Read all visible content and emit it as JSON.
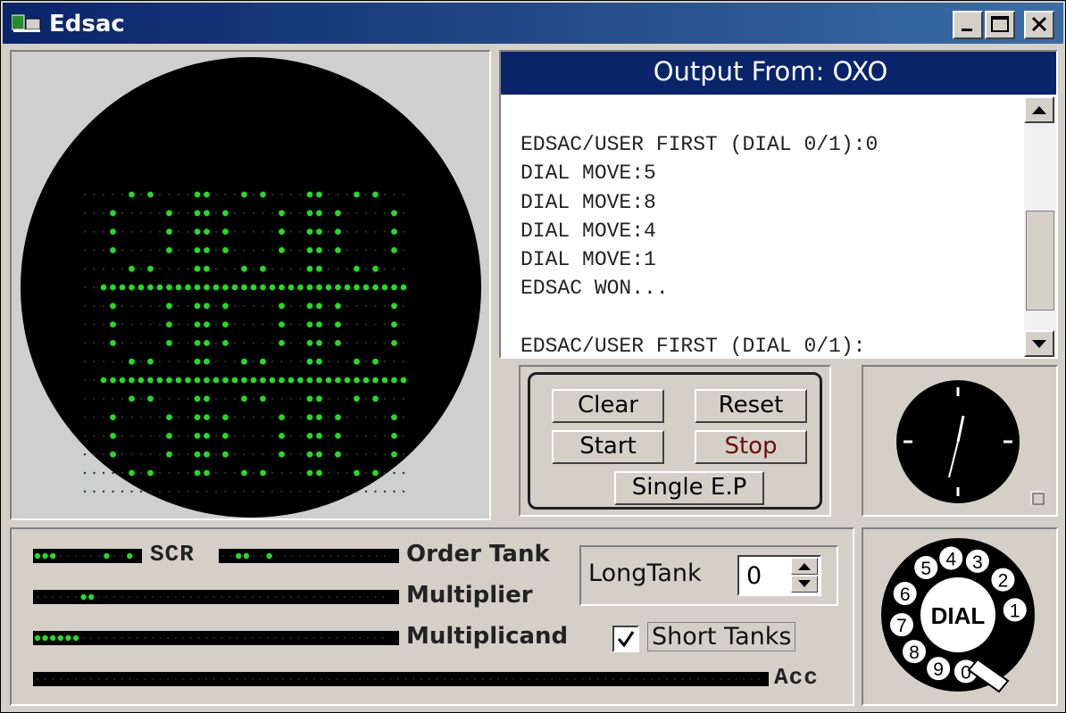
{
  "window": {
    "title": "Edsac"
  },
  "output": {
    "title": "Output From: OXO",
    "lines": [
      "EDSAC/USER FIRST (DIAL 0/1):0",
      "DIAL MOVE:5",
      "DIAL MOVE:8",
      "DIAL MOVE:4",
      "DIAL MOVE:1",
      "EDSAC WON...",
      "",
      "EDSAC/USER FIRST (DIAL 0/1):"
    ]
  },
  "buttons": {
    "clear": "Clear",
    "reset": "Reset",
    "start": "Start",
    "stop": "Stop",
    "single": "Single E.P"
  },
  "registers": {
    "scr": "SCR",
    "order_tank": "Order Tank",
    "multiplier": "Multiplier",
    "multiplicand": "Multiplicand",
    "acc": "Acc"
  },
  "long_tank": {
    "label": "LongTank",
    "value": "0"
  },
  "short_tanks": {
    "label": "Short Tanks",
    "checked": true
  },
  "dial": {
    "label": "DIAL",
    "digits": [
      "1",
      "2",
      "3",
      "4",
      "5",
      "6",
      "7",
      "8",
      "9",
      "0"
    ]
  },
  "colors": {
    "title_bar": "#0a246a",
    "crt_dot": "#22dd22",
    "crt_dim": "#1a3a1a"
  }
}
